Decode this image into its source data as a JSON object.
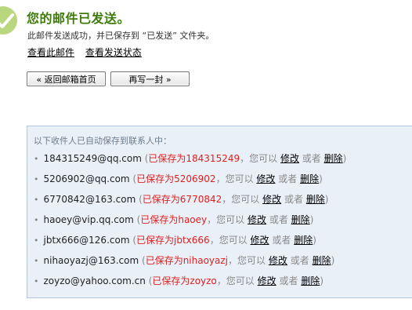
{
  "page": {
    "title": "您的邮件已发送。",
    "subtitle": "此邮件发送成功，并已保存到 “已发送” 文件夹。",
    "links": {
      "view_mail": "查看此邮件",
      "view_status": "查看发送状态"
    },
    "buttons": {
      "back": "« 返回邮箱首页",
      "write_another": "再写一封 »"
    }
  },
  "contacts_panel": {
    "header": "以下收件人已自动保存到联系人中：",
    "separator": "，您可以",
    "edit_label": "修改",
    "or_label": "或者",
    "delete_label": "删除",
    "items": [
      {
        "email": "184315249@qq.com",
        "saved_as": "已保存为184315249"
      },
      {
        "email": "5206902@qq.com",
        "saved_as": "已保存为5206902"
      },
      {
        "email": "6770842@163.com",
        "saved_as": "已保存为6770842"
      },
      {
        "email": "haoey@vip.qq.com",
        "saved_as": "已保存为haoey"
      },
      {
        "email": "jbtx666@126.com",
        "saved_as": "已保存为jbtx666"
      },
      {
        "email": "nihaoyazj@163.com",
        "saved_as": "已保存为nihaoyazj"
      },
      {
        "email": "zoyzo@yahoo.com.cn",
        "saved_as": "已保存为zoyzo"
      }
    ]
  },
  "colors": {
    "title": "#3e7b0c",
    "saved_text": "#e02020",
    "panel_bg": "#e9f0f8",
    "panel_border": "#b4c6dc",
    "success_icon": "#b9d77f"
  },
  "icons": {
    "success": "checkmark-circle-icon"
  }
}
